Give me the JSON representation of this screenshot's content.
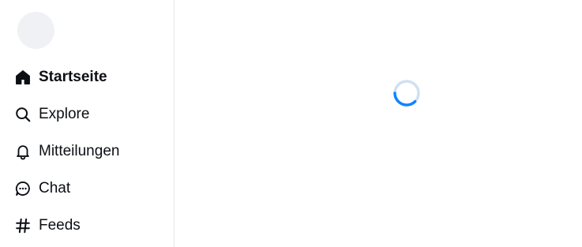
{
  "sidebar": {
    "items": [
      {
        "label": "Startseite",
        "icon": "home-icon",
        "active": true
      },
      {
        "label": "Explore",
        "icon": "search-icon",
        "active": false
      },
      {
        "label": "Mitteilungen",
        "icon": "bell-icon",
        "active": false
      },
      {
        "label": "Chat",
        "icon": "chat-bubble-icon",
        "active": false
      },
      {
        "label": "Feeds",
        "icon": "hash-icon",
        "active": false
      }
    ]
  },
  "main": {
    "loading_indicator": "spinner-icon"
  },
  "colors": {
    "text": "#0b0f14",
    "divider": "#e6e8eb",
    "avatar_placeholder": "#eff1f4",
    "spinner_track": "#cfe0f3",
    "spinner_accent": "#1083fe"
  }
}
